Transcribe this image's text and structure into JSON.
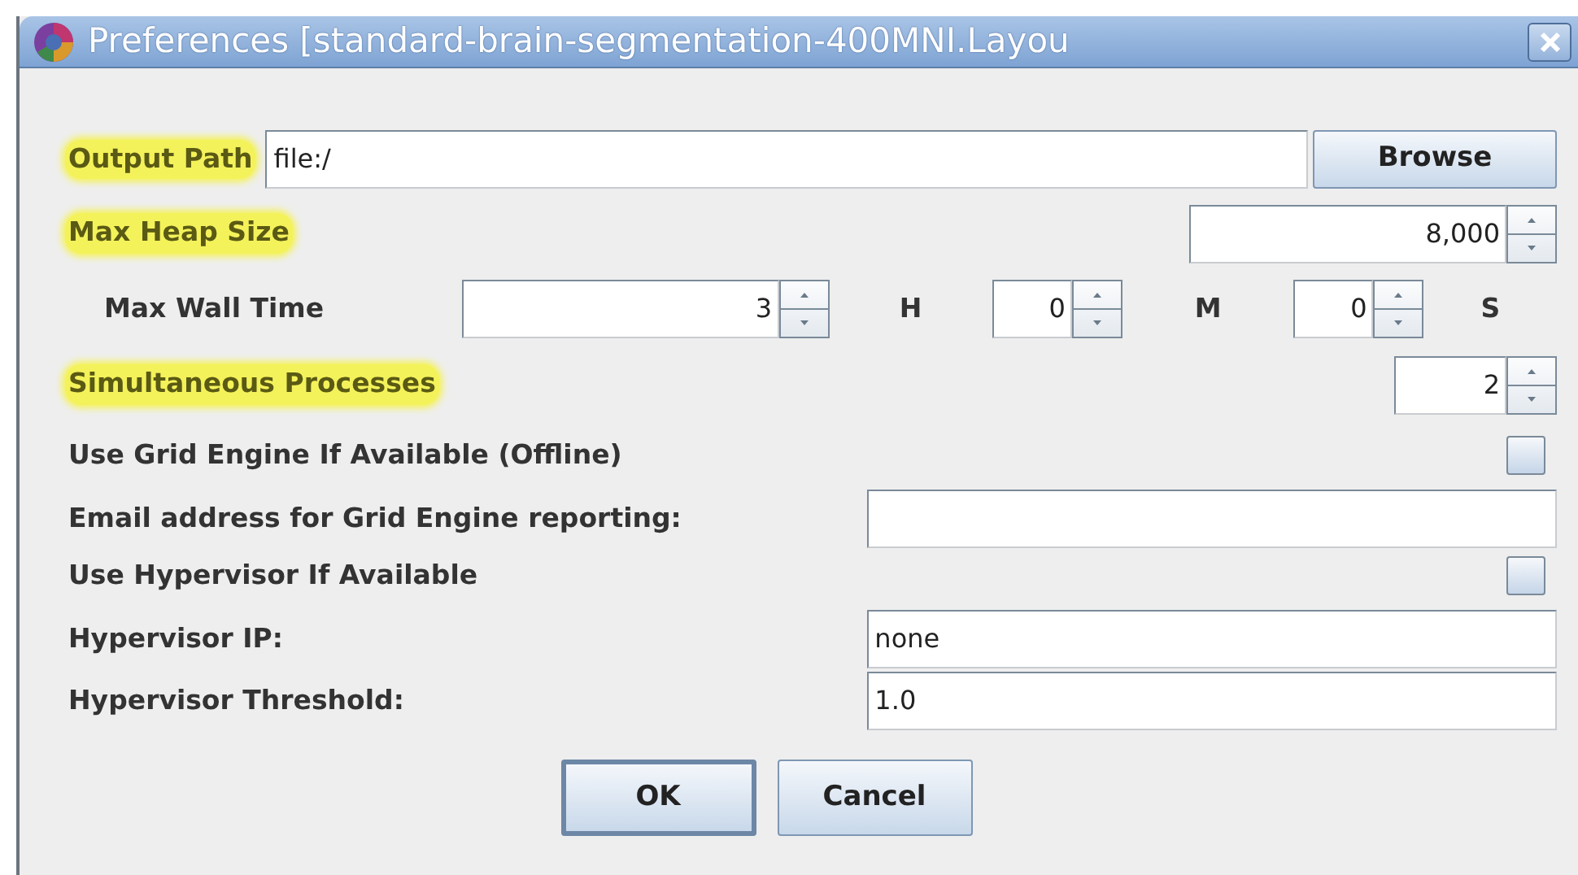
{
  "window": {
    "title": "Preferences [standard-brain-segmentation-400MNI.Layou"
  },
  "rows": [
    {
      "kind": "path",
      "label": "Output Path",
      "highlighted": true,
      "value": "file:/",
      "button": "Browse"
    },
    {
      "kind": "spinner",
      "label": "Max Heap Size",
      "highlighted": true,
      "value": "8,000"
    },
    {
      "kind": "duration",
      "label": "Max Wall Time",
      "highlighted": false,
      "parts": [
        {
          "value": "3",
          "unit": "H"
        },
        {
          "value": "0",
          "unit": "M"
        },
        {
          "value": "0",
          "unit": "S"
        }
      ]
    },
    {
      "kind": "spinner",
      "label": "Simultaneous Processes",
      "highlighted": true,
      "value": "2"
    },
    {
      "kind": "checkbox",
      "label": "Use Grid Engine If Available (Offline)",
      "checked": false
    },
    {
      "kind": "field",
      "label": "Email address for Grid Engine reporting:"
    },
    {
      "kind": "checkbox",
      "label": "Use Hypervisor If Available",
      "checked": false
    },
    {
      "kind": "field",
      "label": "Hypervisor IP:",
      "value": "none"
    },
    {
      "kind": "field",
      "label": "Hypervisor Threshold:",
      "value": "1.0"
    }
  ],
  "buttons": [
    {
      "label": "OK",
      "default": true
    },
    {
      "label": "Cancel",
      "default": false
    }
  ]
}
